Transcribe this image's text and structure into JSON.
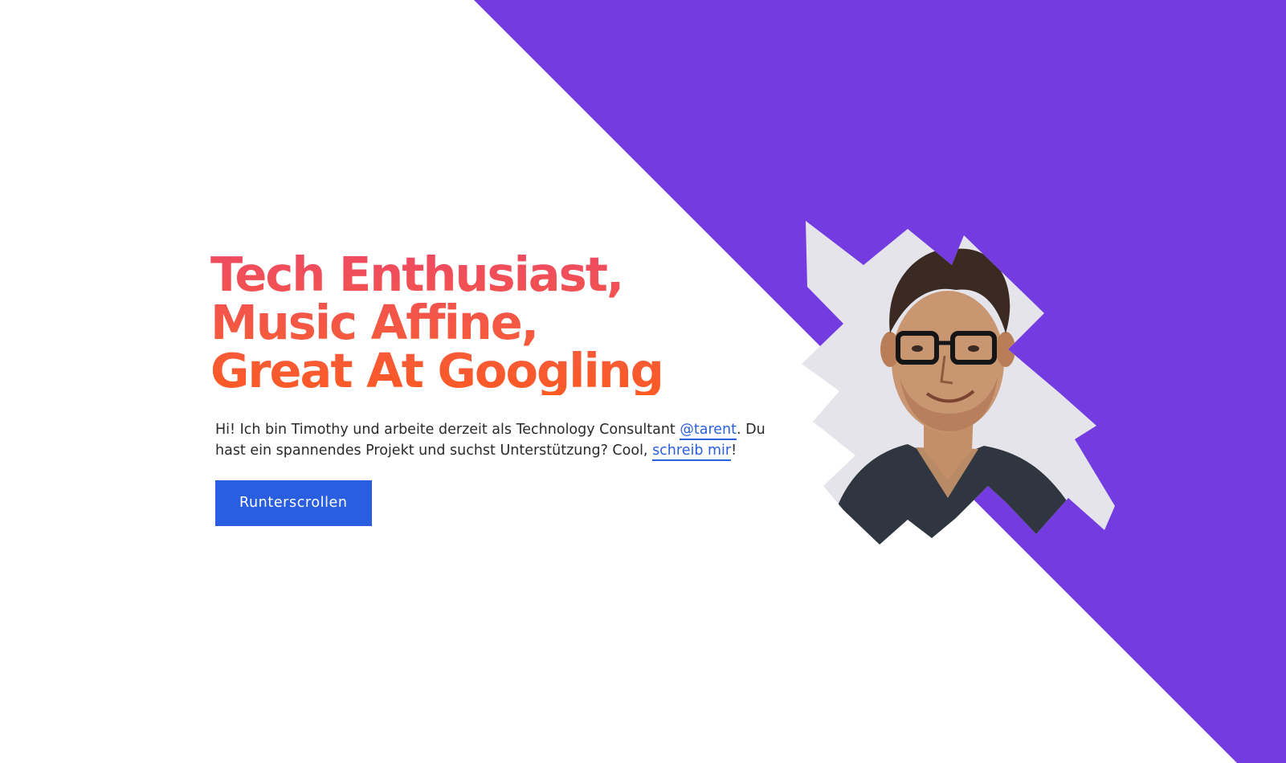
{
  "colors": {
    "background": "#ffffff",
    "purple_accent": "#733be0",
    "headline_gradient_top": "#ee4a63",
    "headline_gradient_bottom": "#fb5a24",
    "link": "#2a5ee0",
    "button": "#2a5ee0",
    "body_text": "#2a2a2a"
  },
  "hero": {
    "headline_lines": [
      "Tech Enthusiast,",
      "Music Affine,",
      "Great At Googling"
    ],
    "intro": {
      "part1": "Hi! Ich bin Timothy und arbeite derzeit als Technology Consultant ",
      "link1": "@tarent",
      "part2": ". Du hast ein spannendes Projekt und suchst Unterstützung? Cool, ",
      "link2": "schreib mir",
      "part3": "!"
    },
    "button_label": "Runterscrollen"
  },
  "icons": {
    "portrait": "portrait-illustration"
  }
}
